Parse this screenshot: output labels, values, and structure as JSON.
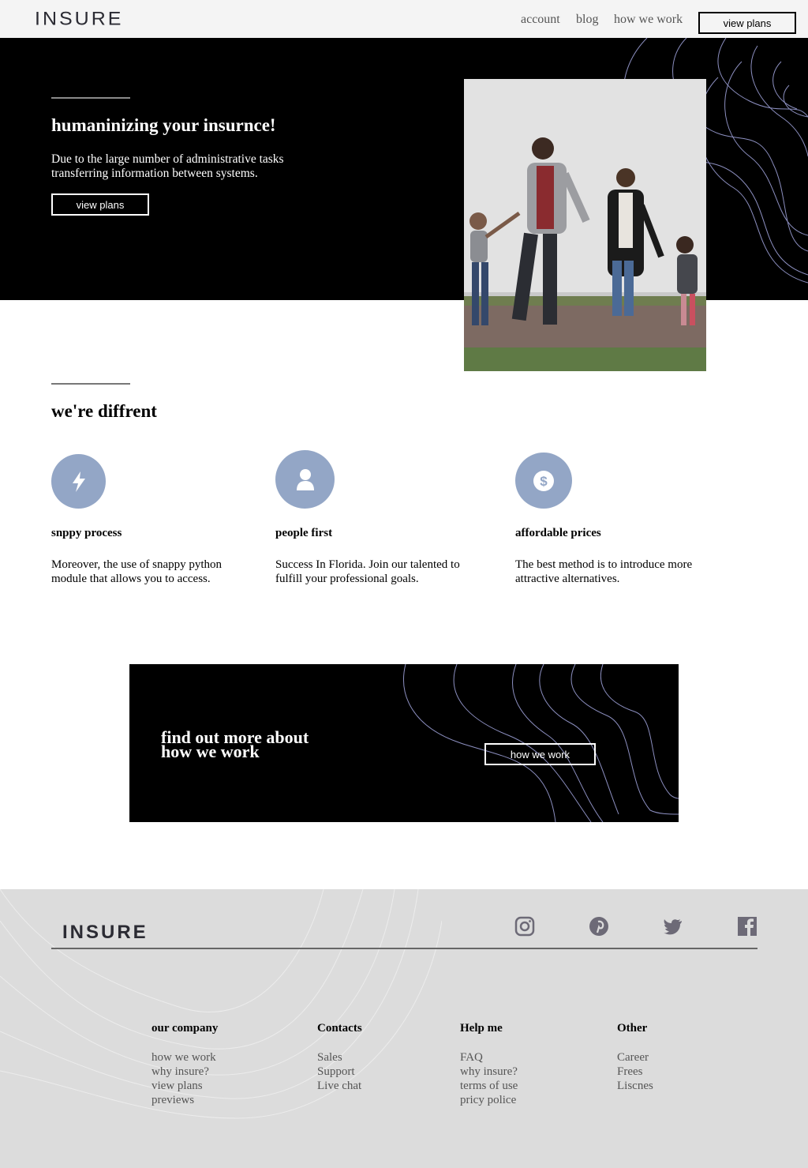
{
  "header": {
    "logo": "INSURE",
    "nav": [
      "account",
      "blog",
      "how we work"
    ],
    "cta_label": "view plans"
  },
  "hero": {
    "title": "humaninizing your insurnce!",
    "text": "Due to the large number of administrative tasks transferring information between systems.",
    "button_label": "view plans"
  },
  "different": {
    "title": "we're diffrent",
    "features": [
      {
        "icon": "lightning-icon",
        "title": "snppy process",
        "text": "Moreover, the use of snappy python module that allows you to access."
      },
      {
        "icon": "person-icon",
        "title": "people first",
        "text": "Success In Florida. Join our talented to fulfill your professional goals."
      },
      {
        "icon": "dollar-icon",
        "title": "affordable prices",
        "text": "The best method is to introduce more attractive alternatives."
      }
    ]
  },
  "cta": {
    "title_line1": "find out more about",
    "title_line2": "how we work",
    "button_label": "how we work"
  },
  "footer": {
    "logo": "INSURE",
    "social": [
      "instagram-icon",
      "pinterest-icon",
      "twitter-icon",
      "facebook-icon"
    ],
    "columns": [
      {
        "title": "our company",
        "links": [
          "how we work",
          "why insure?",
          "view plans",
          "previews"
        ]
      },
      {
        "title": "Contacts",
        "links": [
          "Sales",
          "Support",
          "Live chat"
        ]
      },
      {
        "title": "Help me",
        "links": [
          "FAQ",
          "why insure?",
          "terms of use",
          "pricy police"
        ]
      },
      {
        "title": "Other",
        "links": [
          "Career",
          "Frees",
          "Liscnes"
        ]
      }
    ]
  },
  "colors": {
    "icon_circle": "#93a6c6",
    "contour_lines": "#8c8fc0",
    "footer_bg": "#dcdcdc",
    "header_bg": "#f4f4f4"
  }
}
